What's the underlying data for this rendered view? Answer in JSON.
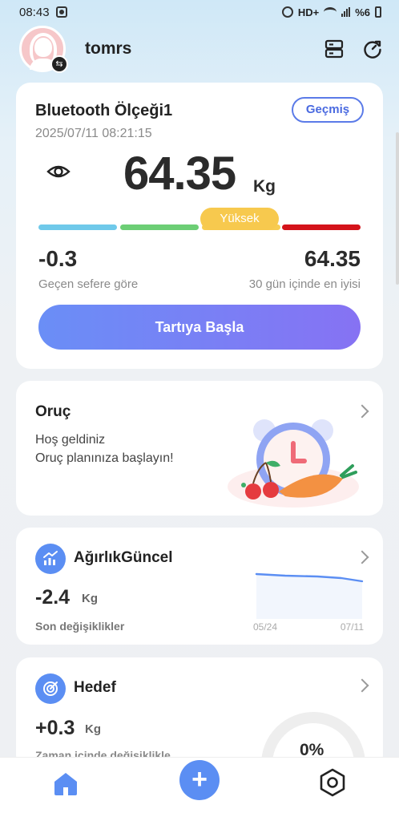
{
  "status_bar": {
    "time": "08:43",
    "network": "HD+",
    "battery": "%6"
  },
  "header": {
    "username": "tomrs"
  },
  "main_card": {
    "scale_name": "Bluetooth Ölçeği1",
    "datetime": "2025/07/11 08:21:15",
    "history_label": "Geçmiş",
    "weight": "64.35",
    "unit": "Kg",
    "level_label": "Yüksek",
    "level_colors": [
      "#6fc9ea",
      "#6cce75",
      "#f7cc52",
      "#d4131a"
    ],
    "diff_value": "-0.3",
    "diff_label": "Geçen sefere göre",
    "best_value": "64.35",
    "best_label": "30 gün içinde en iyisi",
    "start_label": "Tartıya Başla"
  },
  "fasting_card": {
    "title": "Oruç",
    "line1": "Hoş geldiniz",
    "line2": "Oruç planınıza başlayın!"
  },
  "trend_card": {
    "title": "AğırlıkGüncel",
    "value": "-2.4",
    "unit": "Kg",
    "label": "Son değişiklikler",
    "x_start": "05/24",
    "x_end": "07/11"
  },
  "goal_card": {
    "title": "Hedef",
    "value": "+0.3",
    "unit": "Kg",
    "label": "Zaman içinde değişiklikle",
    "progress": "0%"
  },
  "colors": {
    "accent": "#5b8ef3",
    "button_gradient_start": "#6a8ef6",
    "button_gradient_end": "#8672f3"
  }
}
